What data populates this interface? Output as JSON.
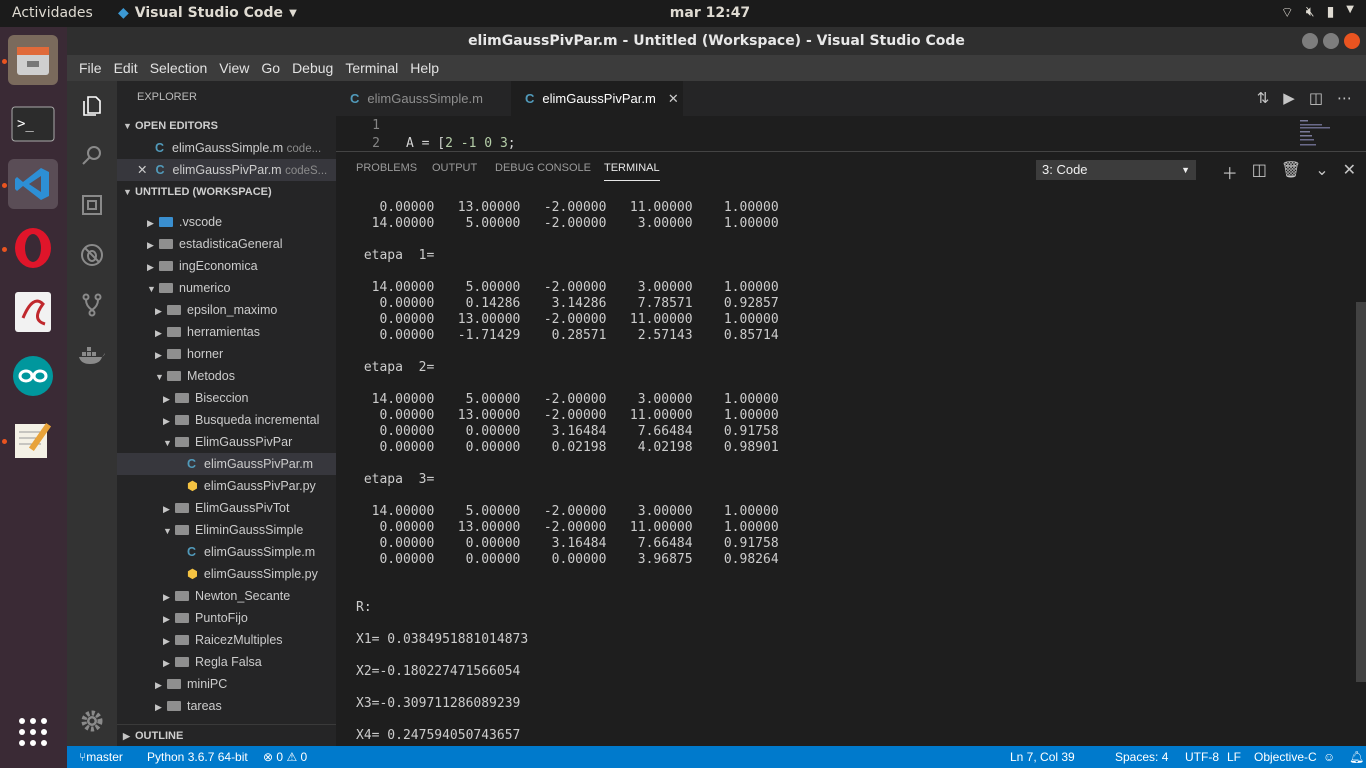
{
  "topbar": {
    "activities": "Actividades",
    "app_menu": "Visual Studio Code",
    "clock": "mar 12:47"
  },
  "window": {
    "title": "elimGaussPivPar.m - Untitled (Workspace) - Visual Studio Code"
  },
  "menubar": [
    "File",
    "Edit",
    "Selection",
    "View",
    "Go",
    "Debug",
    "Terminal",
    "Help"
  ],
  "sidebar": {
    "title": "EXPLORER",
    "open_editors_header": "OPEN EDITORS",
    "open_editors": [
      {
        "name": "elimGaussSimple.m",
        "hint": "code..."
      },
      {
        "name": "elimGaussPivPar.m",
        "hint": "codeS..."
      }
    ],
    "workspace_header": "UNTITLED (WORKSPACE)",
    "tree": [
      {
        "label": ".vscode",
        "type": "folder"
      },
      {
        "label": "estadisticaGeneral",
        "type": "folder"
      },
      {
        "label": "ingEconomica",
        "type": "folder"
      },
      {
        "label": "numerico",
        "type": "folder"
      },
      {
        "label": "epsilon_maximo",
        "type": "folder"
      },
      {
        "label": "herramientas",
        "type": "folder"
      },
      {
        "label": "horner",
        "type": "folder"
      },
      {
        "label": "Metodos",
        "type": "folder"
      },
      {
        "label": "Biseccion",
        "type": "folder"
      },
      {
        "label": "Busqueda incremental",
        "type": "folder"
      },
      {
        "label": "ElimGaussPivPar",
        "type": "folder"
      },
      {
        "label": "elimGaussPivPar.m",
        "type": "file"
      },
      {
        "label": "elimGaussPivPar.py",
        "type": "file"
      },
      {
        "label": "ElimGaussPivTot",
        "type": "folder"
      },
      {
        "label": "EliminGaussSimple",
        "type": "folder"
      },
      {
        "label": "elimGaussSimple.m",
        "type": "file"
      },
      {
        "label": "elimGaussSimple.py",
        "type": "file"
      },
      {
        "label": "Newton_Secante",
        "type": "folder"
      },
      {
        "label": "PuntoFijo",
        "type": "folder"
      },
      {
        "label": "RaicezMultiples",
        "type": "folder"
      },
      {
        "label": "Regla Falsa",
        "type": "folder"
      },
      {
        "label": "miniPC",
        "type": "folder"
      },
      {
        "label": "tareas",
        "type": "folder"
      }
    ],
    "outline_header": "OUTLINE"
  },
  "tabs": [
    {
      "label": "elimGaussSimple.m"
    },
    {
      "label": "elimGaussPivPar.m"
    }
  ],
  "editor": {
    "lines": [
      {
        "n": "1",
        "text": ""
      },
      {
        "n": "2",
        "text": "A = [2 -1 0 3;"
      }
    ]
  },
  "panel": {
    "tabs": [
      "PROBLEMS",
      "OUTPUT",
      "DEBUG CONSOLE",
      "TERMINAL"
    ],
    "terminal_select": "3: Code",
    "terminal_text": "   0.00000   13.00000   -2.00000   11.00000    1.00000\n  14.00000    5.00000   -2.00000    3.00000    1.00000\n\n etapa  1=\n\n  14.00000    5.00000   -2.00000    3.00000    1.00000\n   0.00000    0.14286    3.14286    7.78571    0.92857\n   0.00000   13.00000   -2.00000   11.00000    1.00000\n   0.00000   -1.71429    0.28571    2.57143    0.85714\n\n etapa  2=\n\n  14.00000    5.00000   -2.00000    3.00000    1.00000\n   0.00000   13.00000   -2.00000   11.00000    1.00000\n   0.00000    0.00000    3.16484    7.66484    0.91758\n   0.00000    0.00000    0.02198    4.02198    0.98901\n\n etapa  3=\n\n  14.00000    5.00000   -2.00000    3.00000    1.00000\n   0.00000   13.00000   -2.00000   11.00000    1.00000\n   0.00000    0.00000    3.16484    7.66484    0.91758\n   0.00000    0.00000    0.00000    3.96875    0.98264\n\n\nR:\n\nX1= 0.0384951881014873\n\nX2=-0.180227471566054\n\nX3=-0.309711286089239\n\nX4= 0.247594050743657"
  },
  "status": {
    "branch": "master",
    "python": "Python 3.6.7 64-bit",
    "errors": "0",
    "warnings": "0",
    "position": "Ln 7, Col 39",
    "spaces": "Spaces: 4",
    "encoding": "UTF-8",
    "eol": "LF",
    "language": "Objective-C"
  }
}
